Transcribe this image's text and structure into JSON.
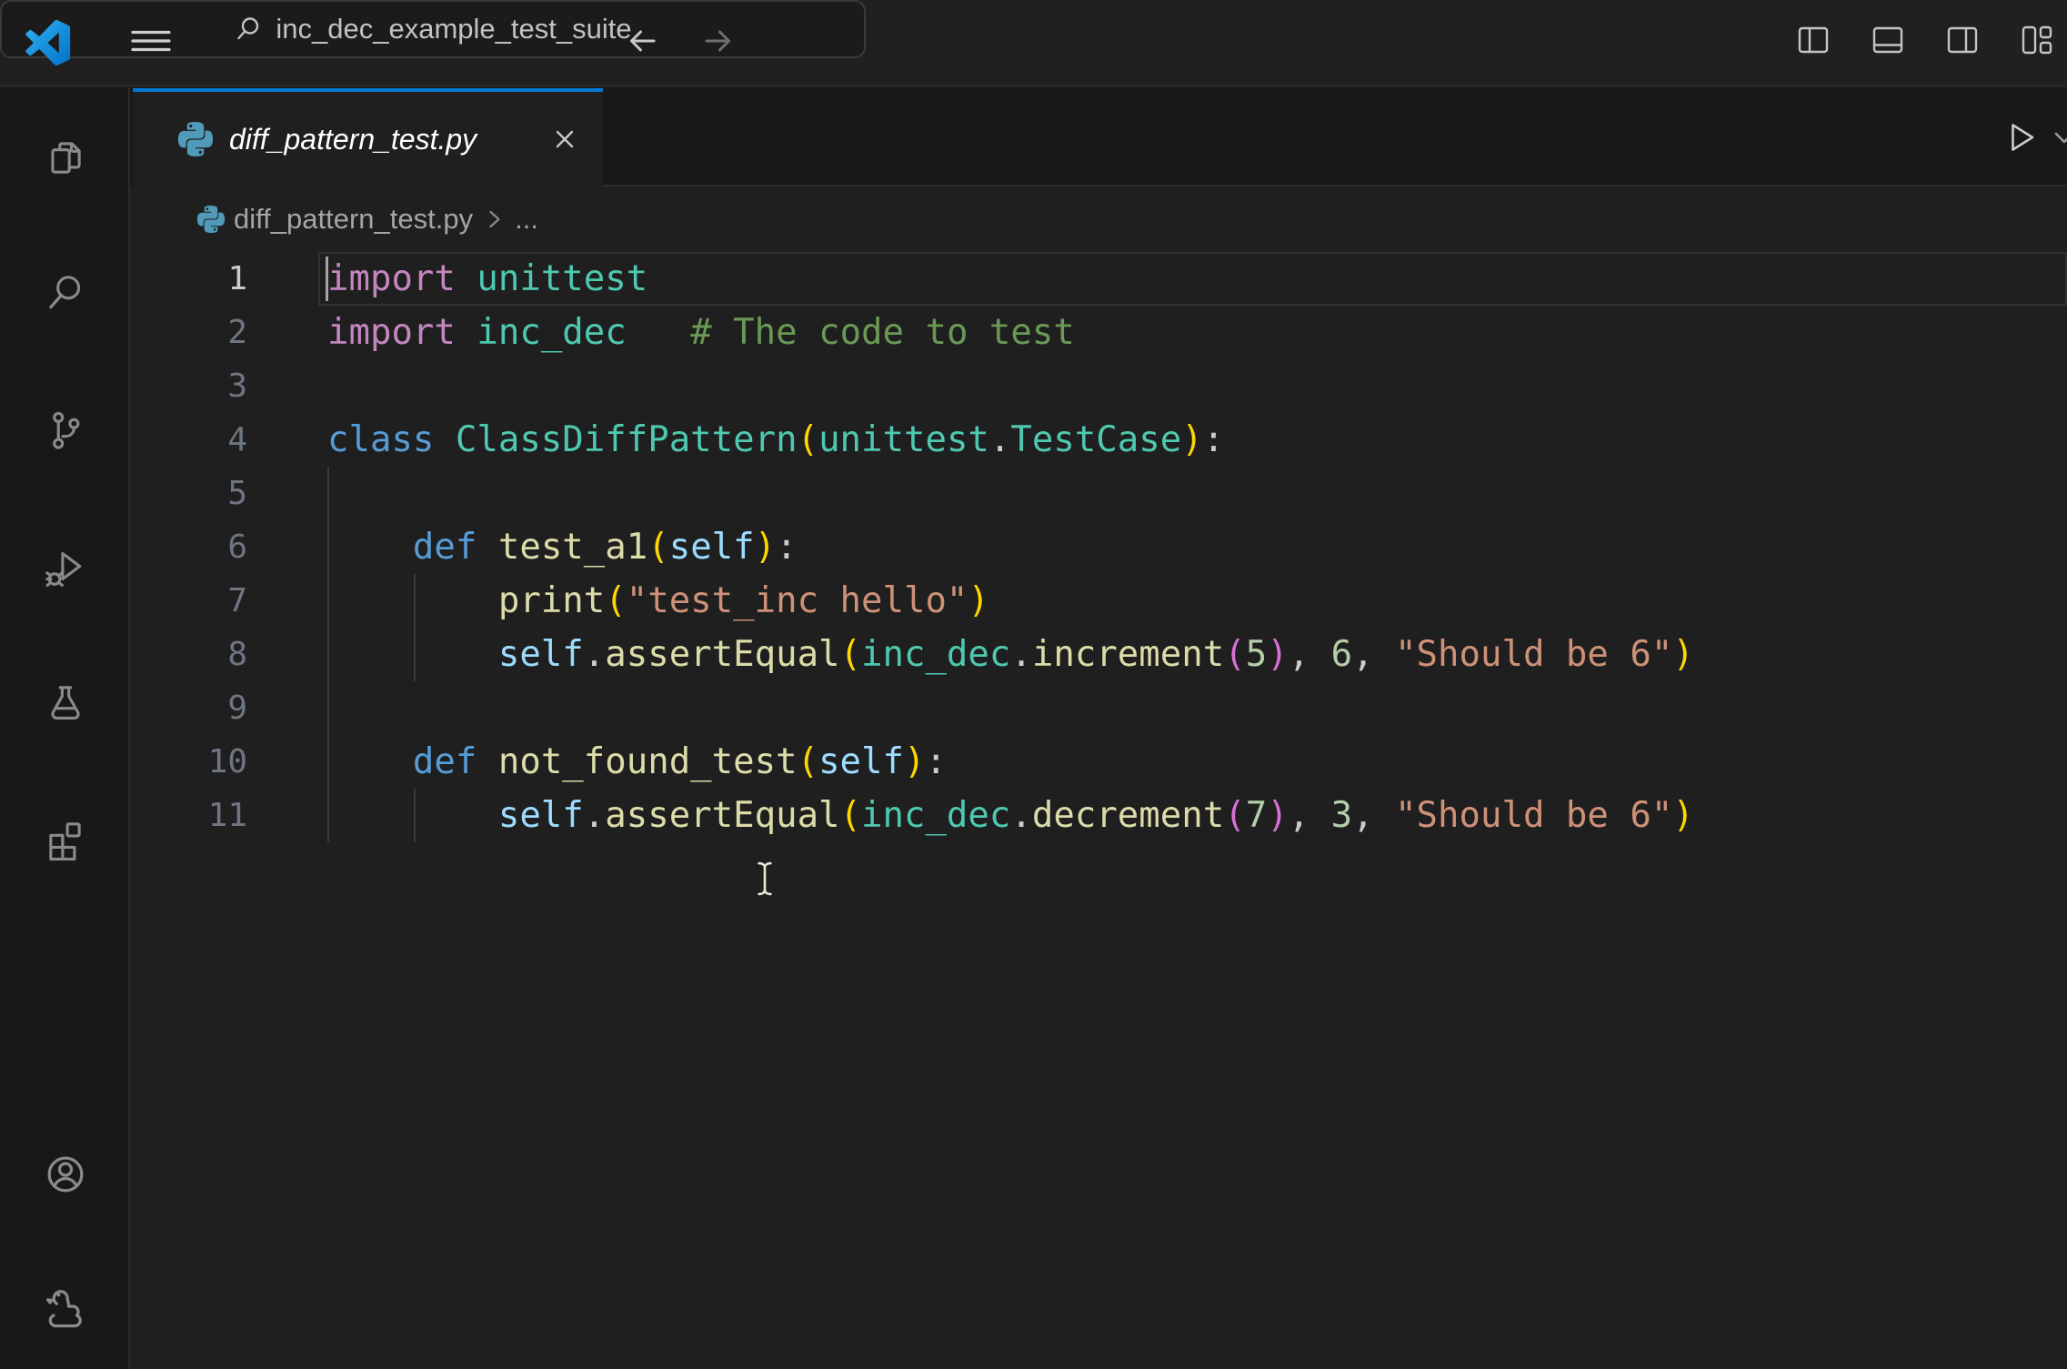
{
  "titlebar": {
    "search_text": "inc_dec_example_test_suite",
    "icons": [
      "vscode-logo",
      "menu",
      "go-back",
      "go-forward",
      "search",
      "toggle-primary-sidebar",
      "toggle-panel",
      "toggle-secondary-sidebar",
      "customize-layout"
    ]
  },
  "activity_bar": {
    "top_icons": [
      "explorer",
      "search",
      "source-control",
      "run-and-debug",
      "testing",
      "extensions"
    ],
    "bottom_icons": [
      "account",
      "python-environments"
    ]
  },
  "editor": {
    "tab": {
      "label": "diff_pattern_test.py",
      "icon": "python-file-icon",
      "preview": true
    },
    "actions": [
      "run",
      "run-options-chevron"
    ],
    "breadcrumb": {
      "file": "diff_pattern_test.py",
      "symbol": "..."
    },
    "active_line": 1,
    "lines": [
      [
        [
          "kw1",
          "import"
        ],
        [
          "plain",
          " "
        ],
        [
          "type",
          "unittest"
        ]
      ],
      [
        [
          "kw1",
          "import"
        ],
        [
          "plain",
          " "
        ],
        [
          "type",
          "inc_dec"
        ],
        [
          "plain",
          "   "
        ],
        [
          "comment",
          "# The code to test"
        ]
      ],
      [],
      [
        [
          "kw2",
          "class"
        ],
        [
          "plain",
          " "
        ],
        [
          "type",
          "ClassDiffPattern"
        ],
        [
          "brk1",
          "("
        ],
        [
          "type",
          "unittest"
        ],
        [
          "plain",
          "."
        ],
        [
          "type",
          "TestCase"
        ],
        [
          "brk1",
          ")"
        ],
        [
          "plain",
          ":"
        ]
      ],
      [],
      [
        [
          "plain",
          "    "
        ],
        [
          "kw2",
          "def"
        ],
        [
          "plain",
          " "
        ],
        [
          "func",
          "test_a1"
        ],
        [
          "brk1",
          "("
        ],
        [
          "var",
          "self"
        ],
        [
          "brk1",
          ")"
        ],
        [
          "plain",
          ":"
        ]
      ],
      [
        [
          "plain",
          "        "
        ],
        [
          "func",
          "print"
        ],
        [
          "brk1",
          "("
        ],
        [
          "str",
          "\"test_inc hello\""
        ],
        [
          "brk1",
          ")"
        ]
      ],
      [
        [
          "plain",
          "        "
        ],
        [
          "var",
          "self"
        ],
        [
          "plain",
          "."
        ],
        [
          "func",
          "assertEqual"
        ],
        [
          "brk1",
          "("
        ],
        [
          "type",
          "inc_dec"
        ],
        [
          "plain",
          "."
        ],
        [
          "func",
          "increment"
        ],
        [
          "brk2",
          "("
        ],
        [
          "num",
          "5"
        ],
        [
          "brk2",
          ")"
        ],
        [
          "plain",
          ", "
        ],
        [
          "num",
          "6"
        ],
        [
          "plain",
          ", "
        ],
        [
          "str",
          "\"Should be 6\""
        ],
        [
          "brk1",
          ")"
        ]
      ],
      [],
      [
        [
          "plain",
          "    "
        ],
        [
          "kw2",
          "def"
        ],
        [
          "plain",
          " "
        ],
        [
          "func",
          "not_found_test"
        ],
        [
          "brk1",
          "("
        ],
        [
          "var",
          "self"
        ],
        [
          "brk1",
          ")"
        ],
        [
          "plain",
          ":"
        ]
      ],
      [
        [
          "plain",
          "        "
        ],
        [
          "var",
          "self"
        ],
        [
          "plain",
          "."
        ],
        [
          "func",
          "assertEqual"
        ],
        [
          "brk1",
          "("
        ],
        [
          "type",
          "inc_dec"
        ],
        [
          "plain",
          "."
        ],
        [
          "func",
          "decrement"
        ],
        [
          "brk2",
          "("
        ],
        [
          "num",
          "7"
        ],
        [
          "brk2",
          ")"
        ],
        [
          "plain",
          ", "
        ],
        [
          "num",
          "3"
        ],
        [
          "plain",
          ", "
        ],
        [
          "str",
          "\"Should be 6\""
        ],
        [
          "brk1",
          ")"
        ]
      ]
    ]
  },
  "colors": {
    "accent_blue": "#0078D4",
    "titlebar_bg": "#202021",
    "editor_bg": "#1F1F1F",
    "activitybar_bg": "#181818",
    "python_icon": "#519ABA",
    "syntax": {
      "kw1": "#C586C0",
      "kw2": "#569CD6",
      "type": "#4EC9B0",
      "func": "#DCDCAA",
      "var": "#9CDCFE",
      "str": "#CE9178",
      "num": "#B5CEA8",
      "brk1": "#FFD700",
      "brk2": "#DA70D6",
      "plain": "#CCCCCC",
      "comment": "#6A9955"
    }
  }
}
